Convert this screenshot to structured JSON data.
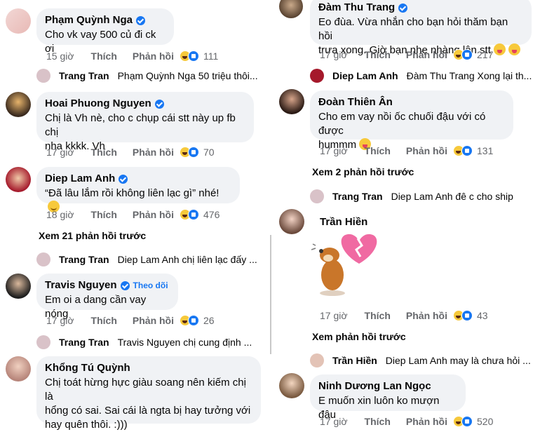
{
  "left_column": {
    "comment_1": {
      "name": "Phạm Quỳnh Nga",
      "text": "Cho vk vay 500 củ đi ck ơi",
      "time": "15 giờ",
      "like": "Thích",
      "reply": "Phản hồi",
      "count": "111"
    },
    "reply_1": {
      "name": "Trang Tran",
      "text": "Phạm Quỳnh Nga  50 triệu thôi..."
    },
    "comment_2": {
      "name": "Hoai Phuong Nguyen",
      "text_line1": "Chị là Vh nè, cho c chụp cái stt này up fb chị",
      "text_line2": "nha kkkk. Vh",
      "time": "17 giờ",
      "like": "Thích",
      "reply": "Phản hồi",
      "count": "70"
    },
    "comment_3": {
      "name": "Diep Lam Anh",
      "text": "“Đã lâu lắm rồi không liên lạc gì” nhé!",
      "time": "18 giờ",
      "like": "Thích",
      "reply": "Phản hồi",
      "count": "476"
    },
    "view_more_1": "Xem 21 phản hồi trước",
    "reply_2": {
      "name": "Trang Tran",
      "text": "Diep Lam Anh  chị liên lạc đấy ..."
    },
    "comment_4": {
      "name": "Travis Nguyen",
      "follow": "Theo dõi",
      "text": "Em oi a dang cần vay nóng",
      "time": "17 giờ",
      "like": "Thích",
      "reply": "Phản hồi",
      "count": "26"
    },
    "reply_3": {
      "name": "Trang Tran",
      "text": "Travis Nguyen  chị cung định ..."
    },
    "comment_5": {
      "name": "Khổng Tú Quỳnh",
      "text_line1": "Chị toát hừng hực giàu soang nên kiếm chị là",
      "text_line2": "hổng có sai. Sai cái là ngta bị hay tưởng với",
      "text_line3": "hay quên thôi. :)))"
    }
  },
  "right_column": {
    "comment_1": {
      "name": "Đàm Thu Trang",
      "text_line1": "Eo đùa. Vừa nhắn cho bạn hỏi thăm bạn hồi",
      "text_line2": "trưa xong. Giờ bạn nhẹ nhàng lên stt",
      "time": "17 giờ",
      "like": "Thích",
      "reply": "Phản hồi",
      "count": "217"
    },
    "reply_1": {
      "name": "Diep Lam Anh",
      "text": "Đàm Thu Trang  Xong lại th..."
    },
    "comment_2": {
      "name": "Đoàn Thiên Ân",
      "text_line1": "Cho em vay nồi ốc chuối đậu với có được",
      "text_line2": "hummm",
      "time": "17 giờ",
      "like": "Thích",
      "reply": "Phản hồi",
      "count": "131"
    },
    "view_more_1": "Xem 2 phản hồi trước",
    "reply_2": {
      "name": "Trang Tran",
      "text": "Diep Lam Anh  đê c cho ship"
    },
    "comment_3": {
      "name": "Trần Hiền",
      "time": "17 giờ",
      "like": "Thích",
      "reply": "Phản hồi",
      "count": "43"
    },
    "view_more_2": "Xem phản hồi trước",
    "reply_3": {
      "name": "Trần Hiền",
      "text": "Diep Lam Anh  may là chưa hỏi ..."
    },
    "comment_4": {
      "name": "Ninh Dương Lan Ngọc",
      "text": "E muốn xin luôn ko mượn đâu",
      "time": "17 giờ",
      "like": "Thích",
      "reply": "Phản hồi",
      "count": "520"
    }
  },
  "colors": {
    "bubble": "#f0f2f5",
    "meta": "#65676b",
    "verified": "#1877f2",
    "haha": "#f7c93b"
  },
  "icons": [
    "verified-badge-icon",
    "haha-reaction-icon",
    "like-reaction-icon",
    "tongue-emoji-icon",
    "smile-emoji-icon",
    "broken-heart-sticker",
    "dog-sticker"
  ]
}
